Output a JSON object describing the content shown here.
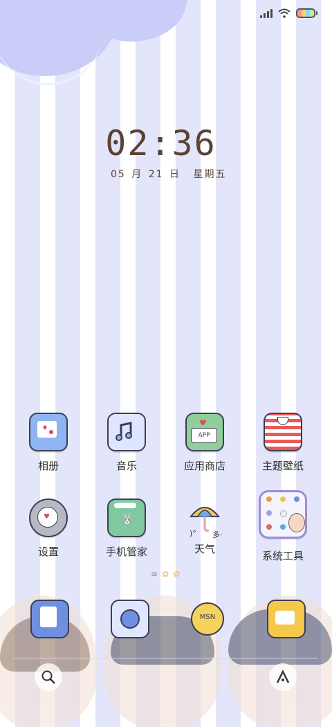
{
  "clock": {
    "time": "02:36"
  },
  "date": {
    "month": "05",
    "month_unit": "月",
    "day": "21",
    "day_unit": "日",
    "weekday": "星期五"
  },
  "apps": [
    {
      "label": "相册",
      "icon": "photos-icon"
    },
    {
      "label": "音乐",
      "icon": "music-icon"
    },
    {
      "label": "应用商店",
      "icon": "app-store-icon"
    },
    {
      "label": "主题壁纸",
      "icon": "theme-wallpaper-icon"
    },
    {
      "label": "设置",
      "icon": "gear-icon"
    },
    {
      "label": "手机管家",
      "icon": "phone-manager-icon"
    },
    {
      "label": "天气",
      "icon": "umbrella-icon"
    },
    {
      "label": "系统工具",
      "icon": "folder-icon"
    }
  ],
  "weather_widget": {
    "temp": ")°",
    "desc": "多·"
  },
  "store_badge": "APP",
  "dock": {
    "apps": [
      "calculator-icon",
      "browser-icon",
      "msn-icon",
      "camera-icon"
    ],
    "msn_text": "MSN"
  },
  "colors": {
    "accent": "#c9cdf7",
    "clock": "#5b4236",
    "folder_border": "#9d8bd6"
  }
}
